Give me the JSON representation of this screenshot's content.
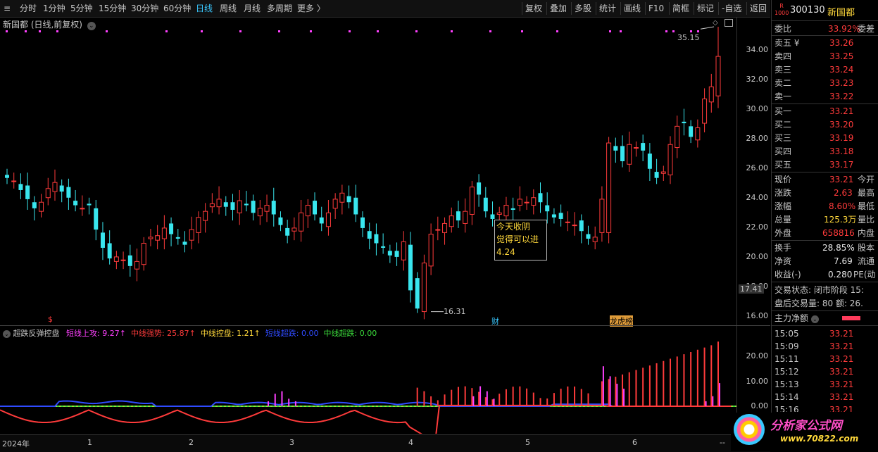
{
  "toolbar": {
    "periods": [
      "分时",
      "1分钟",
      "5分钟",
      "15分钟",
      "30分钟",
      "60分钟",
      "日线",
      "周线",
      "月线",
      "多周期",
      "更多 〉"
    ],
    "active_period": "日线",
    "right_buttons": [
      "复权",
      "叠加",
      "多股",
      "统计",
      "画线",
      "F10",
      "简框",
      "标记",
      "-自选",
      "返回"
    ]
  },
  "chart": {
    "title": "新国都 (日线,前复权)",
    "price_ticks": [
      "34.00",
      "32.00",
      "30.00",
      "28.00",
      "26.00",
      "24.00",
      "22.00",
      "20.00",
      "18.00",
      "16.00"
    ],
    "current_price_tag": "17.41",
    "high_label": "35.15",
    "low_label": "16.31",
    "event_marks": [
      "$",
      "财",
      "龙虎榜"
    ],
    "tooltip": [
      "今天收阴",
      "觉得可以进",
      "4.24"
    ]
  },
  "indicator": {
    "name": "超跌反弹控盘",
    "items": [
      {
        "label": "短线上攻:",
        "value": "9.27↑",
        "color": "#ff40ff"
      },
      {
        "label": "中线强势:",
        "value": "25.87↑",
        "color": "#ff3b3b"
      },
      {
        "label": "中线控盘:",
        "value": "1.21↑",
        "color": "#ffd83b"
      },
      {
        "label": "短线超跌:",
        "value": "0.00",
        "color": "#2f4bff"
      },
      {
        "label": "中线超跌:",
        "value": "0.00",
        "color": "#3bdc3b"
      }
    ],
    "ticks": [
      "20.00",
      "10.00",
      "0.00"
    ]
  },
  "dates": [
    "2024年",
    "1",
    "2",
    "3",
    "4",
    "5",
    "6",
    "--"
  ],
  "panel": {
    "code": "300130",
    "name": "新国都",
    "badge_top": "R",
    "badge_bottom": "1000",
    "weibi": {
      "label": "委比",
      "value": "33.92%",
      "tail": "委差"
    },
    "asks": [
      [
        "卖五 ¥",
        "33.26"
      ],
      [
        "卖四",
        "33.25"
      ],
      [
        "卖三",
        "33.24"
      ],
      [
        "卖二",
        "33.23"
      ],
      [
        "卖一",
        "33.22"
      ]
    ],
    "bids": [
      [
        "买一",
        "33.21"
      ],
      [
        "买二",
        "33.20"
      ],
      [
        "买三",
        "33.19"
      ],
      [
        "买四",
        "33.18"
      ],
      [
        "买五",
        "33.17"
      ]
    ],
    "stats": [
      [
        "现价",
        "33.21",
        "今开"
      ],
      [
        "涨跌",
        "2.63",
        "最高"
      ],
      [
        "涨幅",
        "8.60%",
        "最低"
      ],
      [
        "总量",
        "125.3万",
        "量比"
      ],
      [
        "外盘",
        "658816",
        "内盘"
      ]
    ],
    "stats2": [
      [
        "换手",
        "28.85%",
        "股本"
      ],
      [
        "净资",
        "7.69",
        "流通"
      ],
      [
        "收益(-)",
        "0.280",
        "PE(动"
      ]
    ],
    "trade_state": "交易状态: 闭市阶段 15:",
    "after_hours": "盘后交易量: 80  额: 26.",
    "main_flow": "主力净额",
    "ticks_list": [
      [
        "15:05",
        "33.21"
      ],
      [
        "15:09",
        "33.21"
      ],
      [
        "15:11",
        "33.21"
      ],
      [
        "15:12",
        "33.21"
      ],
      [
        "15:13",
        "33.21"
      ],
      [
        "15:14",
        "33.21"
      ],
      [
        "15:16",
        "33.21"
      ]
    ]
  },
  "watermark": {
    "text": "分析家公式网",
    "url": "www.70822.com"
  },
  "colors": {
    "up": "#ff3b3b",
    "down": "#39e6ee",
    "accent": "#39c8ff",
    "magenta": "#ff40ff"
  },
  "chart_data": {
    "type": "candlestick",
    "ylim": [
      15.5,
      35.8
    ],
    "high": 35.15,
    "low": 16.31,
    "closes": [
      25.2,
      25.0,
      24.4,
      23.8,
      23.2,
      23.6,
      24.5,
      24.9,
      24.3,
      23.9,
      23.4,
      23.2,
      23.4,
      21.8,
      20.6,
      19.9,
      20.0,
      19.8,
      19.4,
      19.7,
      20.9,
      21.3,
      21.4,
      21.9,
      21.5,
      21.2,
      20.8,
      21.8,
      22.6,
      23.0,
      23.5,
      23.8,
      23.3,
      23.1,
      23.7,
      23.4,
      22.9,
      23.2,
      23.4,
      22.8,
      22.1,
      21.4,
      21.9,
      22.9,
      23.4,
      22.8,
      22.2,
      22.9,
      23.8,
      24.2,
      23.6,
      22.8,
      21.9,
      21.2,
      20.9,
      20.6,
      20.1,
      20.0,
      21.0,
      17.8,
      16.6,
      19.6,
      21.5,
      21.8,
      22.2,
      22.7,
      22.4,
      23.0,
      24.6,
      24.1,
      23.0,
      22.5,
      22.9,
      23.4,
      23.1,
      23.8,
      23.6,
      23.9,
      23.6,
      23.0,
      22.6,
      22.5,
      22.3,
      22.1,
      21.7,
      21.2,
      21.3,
      23.8,
      27.5,
      27.0,
      26.3,
      27.4,
      27.2,
      27.0,
      25.8,
      25.2,
      25.6,
      27.4,
      28.6,
      28.8,
      27.9,
      28.5,
      30.4,
      31.2,
      33.2
    ]
  }
}
